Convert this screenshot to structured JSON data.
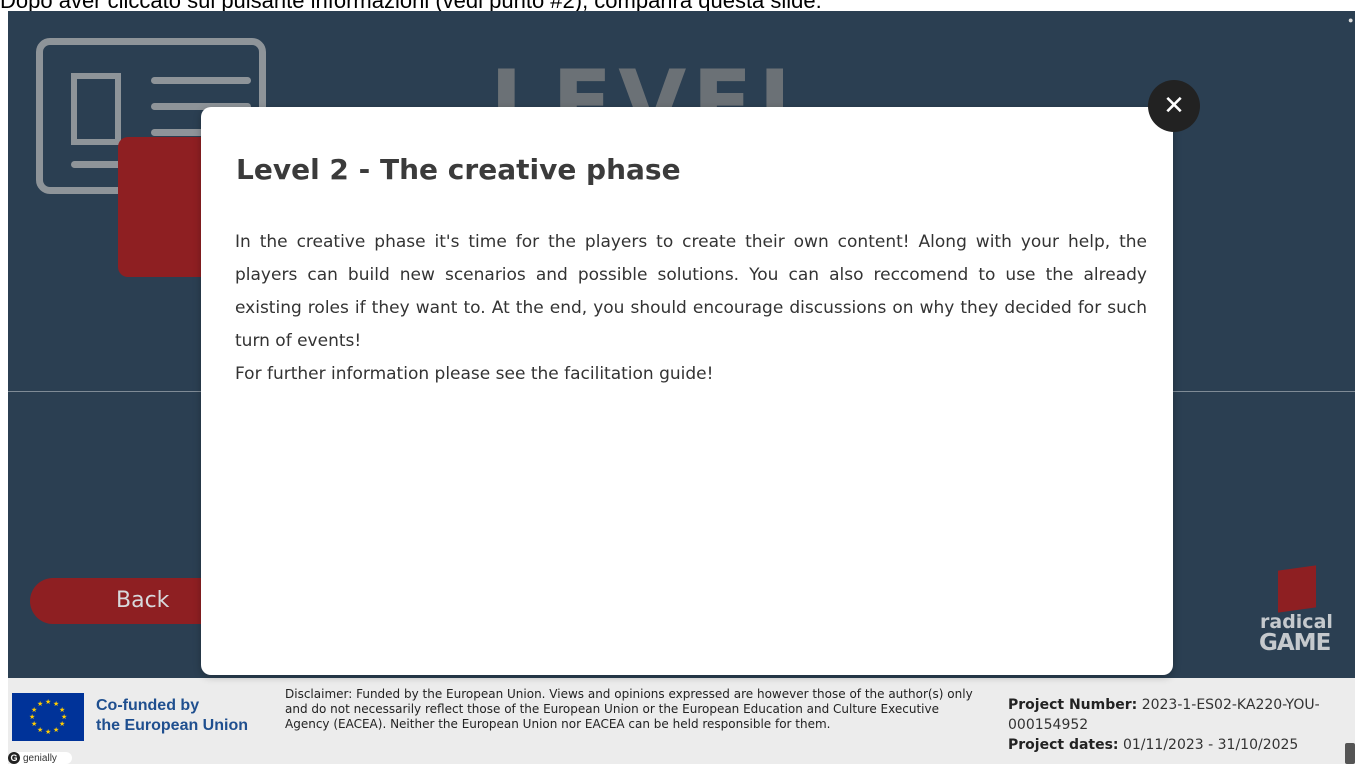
{
  "caption": "Dopo aver cliccato sul pulsante informazioni (vedi punto #2), comparirà questa slide:",
  "slide": {
    "background_title": "LEVEL",
    "back_label": "Back",
    "brand_line1": "radical",
    "brand_line2": "GAME"
  },
  "modal": {
    "title": "Level 2 - The creative phase",
    "paragraph1": "In the creative phase it's time for the players to create their own content!  Along with your help, the players can build new scenarios and possible solutions. You can also reccomend to use the already existing roles if they want to. At the end, you should encourage discussions on why they decided for such turn of events!",
    "paragraph2": "For further information please see the facilitation guide!",
    "close_glyph": "✕"
  },
  "footer": {
    "cofunded_line1": "Co-funded by",
    "cofunded_line2": "the European Union",
    "disclaimer": "Disclaimer: Funded by the European Union. Views and opinions expressed are however those of the author(s) only and do not necessarily reflect those of the European Union or the European Education and Culture Executive Agency (EACEA). Neither the European Union nor EACEA can be held responsible for them.",
    "project_number_label": "Project Number:",
    "project_number_value": "2023-1-ES02-KA220-YOU-000154952",
    "project_dates_label": "Project dates:",
    "project_dates_value": "01/11/2023 - 31/10/2025",
    "genially_label": "genially"
  },
  "icons": {
    "close": "close-icon",
    "id_card": "id-card-icon",
    "eu_flag": "eu-flag-icon",
    "genially_logo": "genially-logo-icon"
  },
  "colors": {
    "slide_bg": "#2b3f52",
    "accent_red": "#8e1f22",
    "modal_bg": "#ffffff",
    "eu_blue": "#003399",
    "eu_gold": "#ffcc00"
  }
}
